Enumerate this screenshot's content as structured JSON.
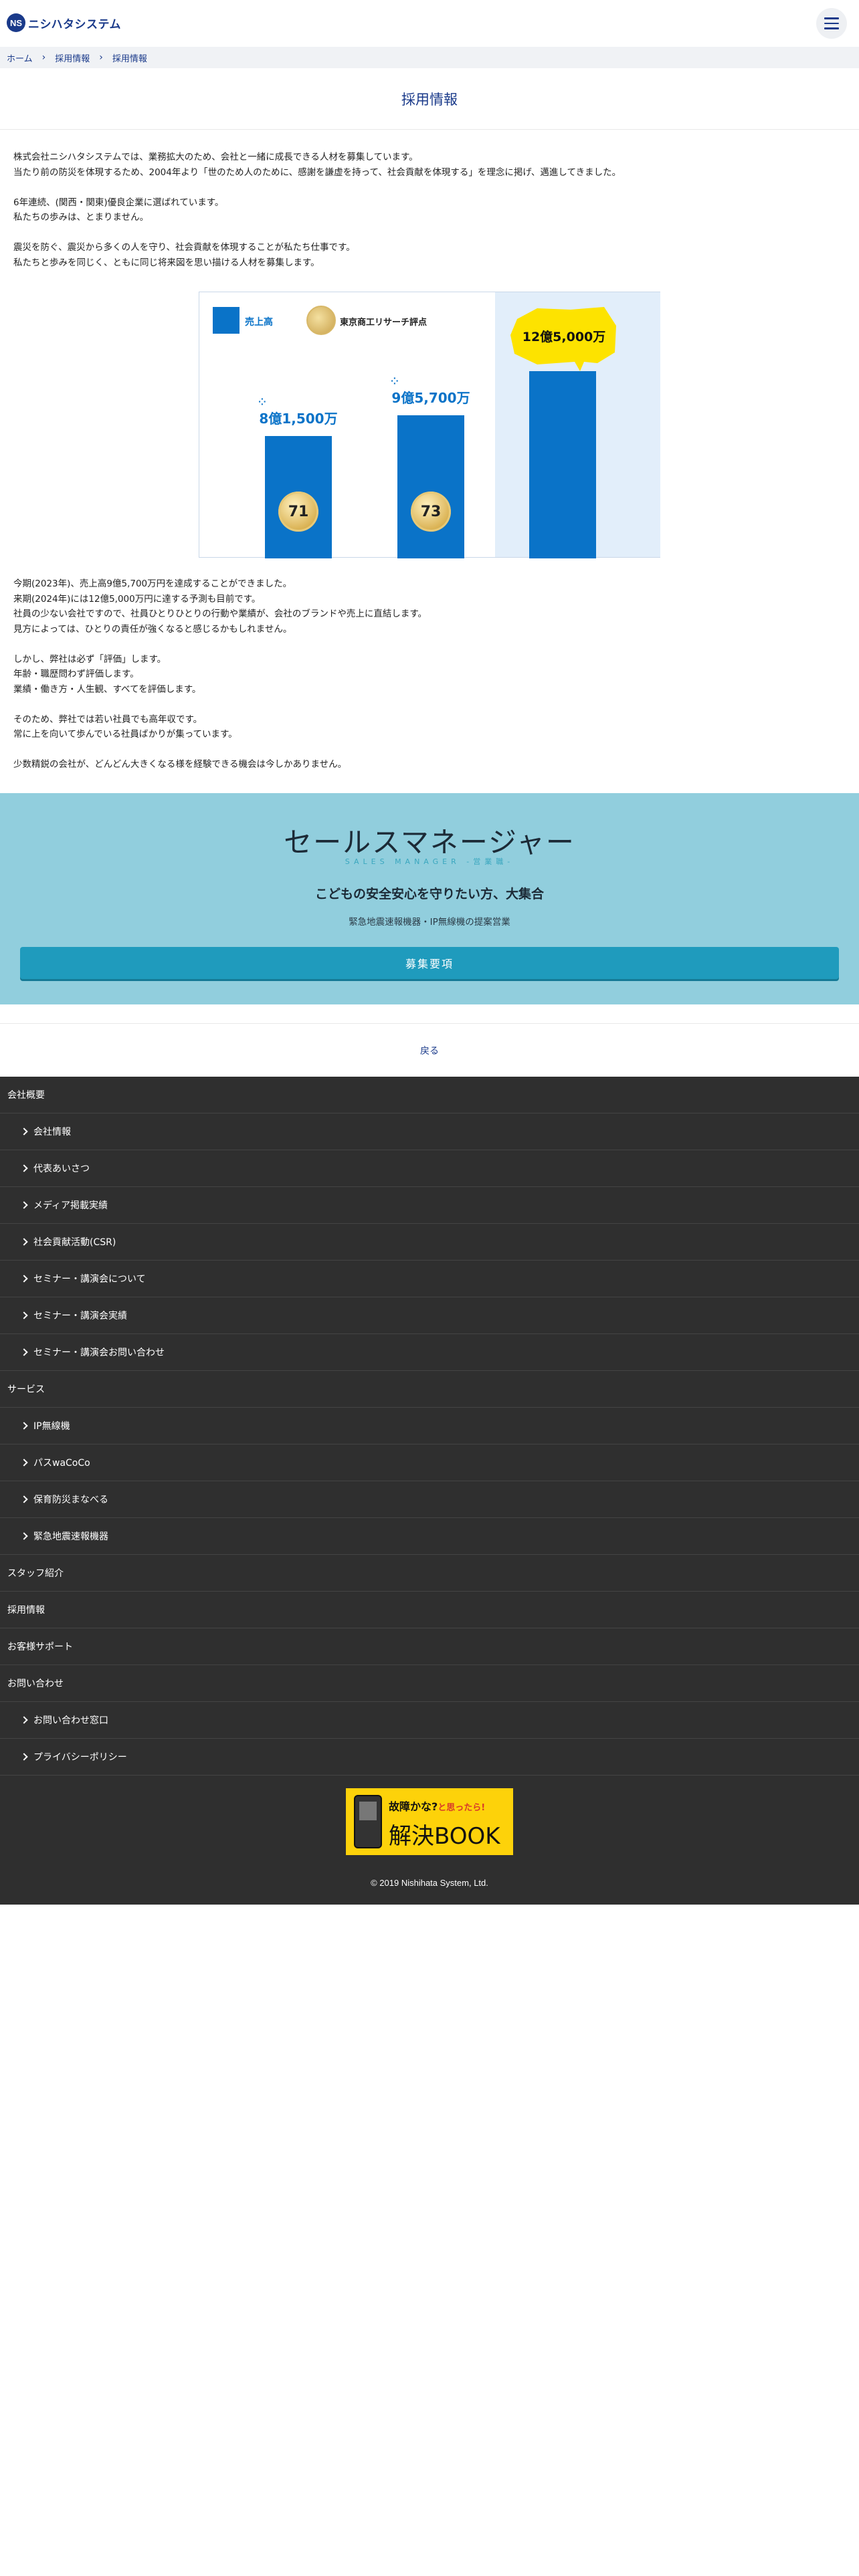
{
  "header": {
    "logo_mark": "NS",
    "logo_text": "ニシハタシステム"
  },
  "breadcrumb": [
    "ホーム",
    "採用情報",
    "採用情報"
  ],
  "page_title": "採用情報",
  "intro": [
    "株式会社ニシハタシステムでは、業務拡大のため、会社と一緒に成長できる人材を募集しています。",
    "当たり前の防災を体現するため、2004年より「世のため人のために、感謝を謙虚を持って、社会貢献を体現する」を理念に掲げ、邁進してきました。",
    "",
    "6年連続、(関西・関東)優良企業に選ばれています。",
    "私たちの歩みは、とまりません。",
    "",
    "震災を防ぐ、震災から多くの人を守り、社会貢献を体現することが私たち仕事です。",
    "私たちと歩みを同じく、ともに同じ将来図を思い描ける人材を募集します。"
  ],
  "chart_data": {
    "type": "bar",
    "legend": {
      "sales_label": "売上高",
      "score_label": "東京商工リサーチ評点"
    },
    "categories": [
      "",
      "",
      ""
    ],
    "value_labels": [
      "8億1,500万",
      "9億5,700万",
      "12億5,000万"
    ],
    "values": [
      815,
      957,
      1250
    ],
    "scores": [
      "71",
      "73",
      ""
    ],
    "unit": "百万円",
    "colors": {
      "bar": "#0a73c8",
      "highlight_bg": "#e2eefa",
      "bubble": "#fde300"
    }
  },
  "body": [
    "今期(2023年)、売上高9億5,700万円を達成することができました。",
    "来期(2024年)には12億5,000万円に達する予測も目前です。",
    "社員の少ない会社ですので、社員ひとりひとりの行動や業績が、会社のブランドや売上に直結します。",
    "見方によっては、ひとりの責任が強くなると感じるかもしれません。",
    "",
    "しかし、弊社は必ず「評価」します。",
    "年齢・職歴問わず評価します。",
    "業績・働き方・人生観、すべてを評価します。",
    "",
    "そのため、弊社では若い社員でも高年収です。",
    "常に上を向いて歩んでいる社員ばかりが集っています。",
    "",
    "少数精鋭の会社が、どんどん大きくなる様を経験できる機会は今しかありません。"
  ],
  "sales": {
    "title": "セールスマネージャー",
    "subtitle": "SALES MANAGER -営業職-",
    "catch": "こどもの安全安心を守りたい方、大集合",
    "desc": "緊急地震速報機器・IP無線機の提案営業",
    "button": "募集要項"
  },
  "back_label": "戻る",
  "footer_nav": [
    {
      "label": "会社概要",
      "level": 0
    },
    {
      "label": "会社情報",
      "level": 1
    },
    {
      "label": "代表あいさつ",
      "level": 1
    },
    {
      "label": "メディア掲載実績",
      "level": 1
    },
    {
      "label": "社会貢献活動(CSR)",
      "level": 1
    },
    {
      "label": "セミナー・講演会について",
      "level": 1
    },
    {
      "label": "セミナー・講演会実績",
      "level": 1
    },
    {
      "label": "セミナー・講演会お問い合わせ",
      "level": 1
    },
    {
      "label": "サービス",
      "level": 0
    },
    {
      "label": "IP無線機",
      "level": 1
    },
    {
      "label": "パスwaCoCo",
      "level": 1
    },
    {
      "label": "保育防災まなべる",
      "level": 1
    },
    {
      "label": "緊急地震速報機器",
      "level": 1
    },
    {
      "label": "スタッフ紹介",
      "level": 0
    },
    {
      "label": "採用情報",
      "level": 0
    },
    {
      "label": "お客様サポート",
      "level": 0
    },
    {
      "label": "お問い合わせ",
      "level": 0
    },
    {
      "label": "お問い合わせ窓口",
      "level": 1
    },
    {
      "label": "プライバシーポリシー",
      "level": 1
    }
  ],
  "banner": {
    "top_text": "故障かな?",
    "top_small": "と思ったら!",
    "main_text": "解決BOOK"
  },
  "copyright": "© 2019 Nishihata System, Ltd."
}
